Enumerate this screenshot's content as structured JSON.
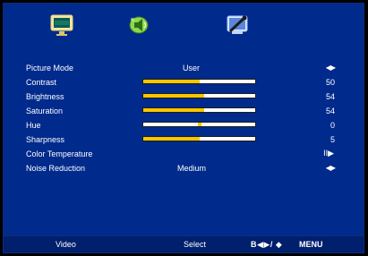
{
  "tabs": [
    {
      "name": "Picture",
      "icon": "picture-menu-icon"
    },
    {
      "name": "Sound",
      "icon": "sound-menu-icon"
    },
    {
      "name": "Setup",
      "icon": "setup-menu-icon"
    }
  ],
  "menu": {
    "picture_mode": {
      "label": "Picture Mode",
      "value": "User",
      "arrows": "◀▶"
    },
    "contrast": {
      "label": "Contrast",
      "value": "50",
      "level_percent": 50
    },
    "brightness": {
      "label": "Brightness",
      "value": "54",
      "level_percent": 54
    },
    "saturation": {
      "label": "Saturation",
      "value": "54",
      "level_percent": 54
    },
    "hue": {
      "label": "Hue",
      "value": "0",
      "level": 0,
      "range": [
        -50,
        50
      ]
    },
    "sharpness": {
      "label": "Sharpness",
      "value": "5",
      "level_percent": 50
    },
    "color_temperature": {
      "label": "Color Temperature",
      "indicator": "II▶"
    },
    "noise_reduction": {
      "label": "Noise Reduction",
      "value": "Medium",
      "arrows": "◀▶"
    }
  },
  "footer": {
    "left": "Video",
    "select": "Select",
    "nav": "B◀▶/ ◆",
    "menu": "MENU"
  },
  "colors": {
    "background": "#002a8c",
    "bar_fill": "#f7c600",
    "text": "#ffffff"
  }
}
